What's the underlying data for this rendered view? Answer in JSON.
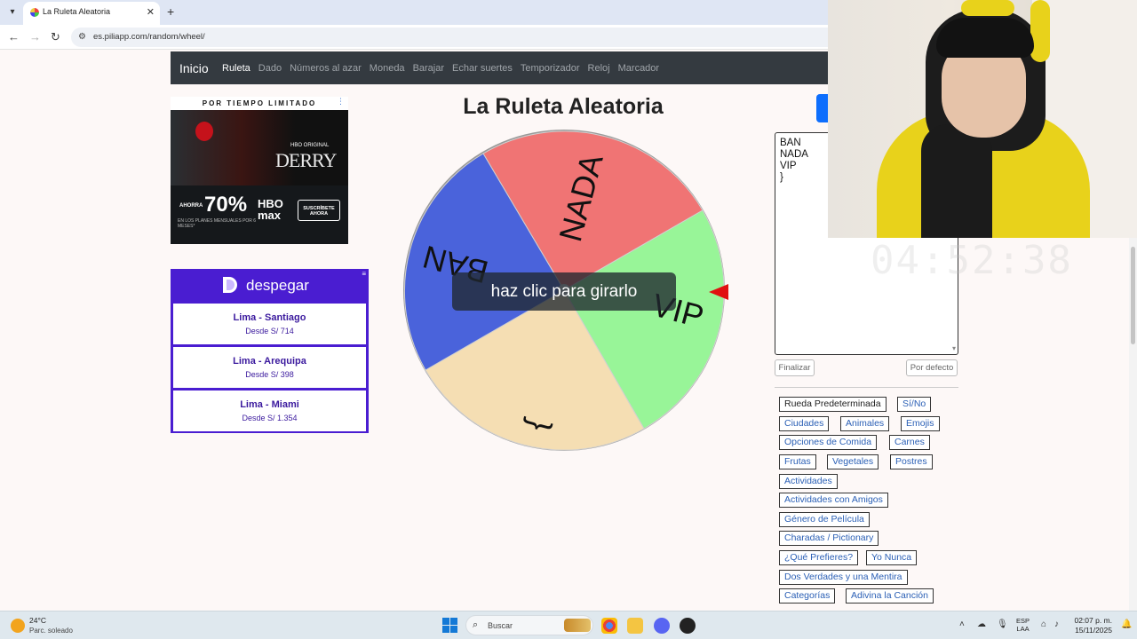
{
  "browser": {
    "tab_title": "La Ruleta Aleatoria",
    "tab_close": "✕",
    "new_tab": "+",
    "url": "es.piliapp.com/random/wheel/"
  },
  "nav": {
    "brand": "Inicio",
    "links": [
      "Ruleta",
      "Dado",
      "Números al azar",
      "Moneda",
      "Barajar",
      "Echar suertes",
      "Temporizador",
      "Reloj",
      "Marcador"
    ]
  },
  "ad_hbo": {
    "header": "POR TIEMPO LIMITADO",
    "hbo_original": "HBO ORIGINAL",
    "show": "DERRY",
    "ahorra": "AHORRA",
    "percent": "70%",
    "subtext": "EN LOS PLANES MENSUALES POR 6 MESES*",
    "brand": "HBO max",
    "cta": "SUSCRÍBETE AHORA"
  },
  "ad_despegar": {
    "brand": "despegar",
    "routes": [
      {
        "route": "Lima - Santiago",
        "price": "Desde S/ 714"
      },
      {
        "route": "Lima - Arequipa",
        "price": "Desde S/ 398"
      },
      {
        "route": "Lima - Miami",
        "price": "Desde S/ 1.354"
      }
    ]
  },
  "main": {
    "title": "La Ruleta Aleatoria",
    "spin_message": "haz clic para girarlo"
  },
  "wheel": {
    "segments": [
      {
        "label": "NADA",
        "color": "#f07474"
      },
      {
        "label": "VIP",
        "color": "#98f598"
      },
      {
        "label": "}",
        "color": "#f5deb3"
      },
      {
        "label": "BAN",
        "color": "#4a63db"
      }
    ],
    "pointer_color": "#e01010"
  },
  "editor": {
    "lines": [
      "BAN",
      "NADA",
      "VIP",
      "}"
    ]
  },
  "buttons": {
    "finish": "Finalizar",
    "default": "Por defecto"
  },
  "presets": [
    "Rueda Predeterminada",
    "Sí/No",
    "Ciudades",
    "Animales",
    "Emojis",
    "Opciones de Comida",
    "Carnes",
    "Frutas",
    "Vegetales",
    "Postres",
    "Actividades",
    "Actividades con Amigos",
    "Género de Película",
    "Charadas / Pictionary",
    "¿Qué Prefieres?",
    "Yo Nunca",
    "Dos Verdades y una Mentira",
    "Categorías",
    "Adivina la Canción"
  ],
  "overlay_clock": "04:52:38",
  "taskbar": {
    "temperature": "24°C",
    "condition": "Parc. soleado",
    "search": "Buscar",
    "lang_top": "ESP",
    "lang_bottom": "LAA",
    "time": "02:07 p. m.",
    "date": "15/11/2025"
  },
  "colors": {
    "navbar": "#343a40",
    "despegar": "#4a1dd1",
    "link": "#2a5fb5"
  }
}
